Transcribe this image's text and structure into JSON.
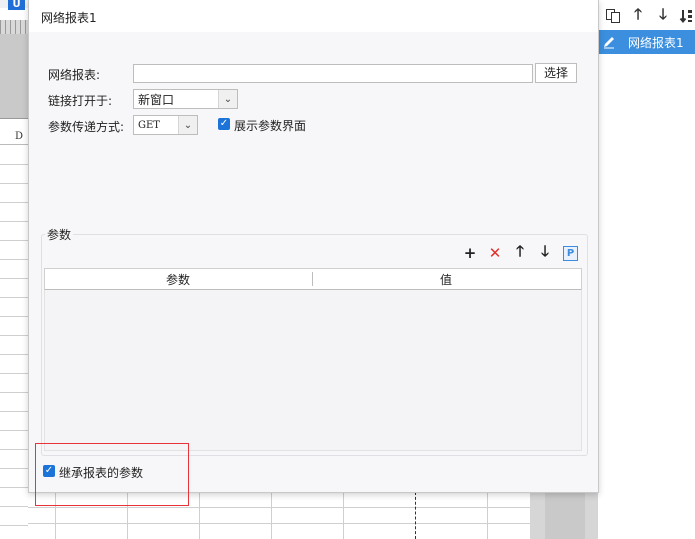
{
  "background": {
    "toolbar_badge": "U",
    "column_header": "D"
  },
  "dialog": {
    "title": "网络报表1",
    "report_label": "网络报表:",
    "report_value": "",
    "select_button": "选择",
    "link_open_label": "链接打开于:",
    "link_open_value": "新窗口",
    "param_method_label": "参数传递方式:",
    "param_method_value": "GET",
    "show_params_label": "展示参数界面",
    "show_params_checked": true,
    "params_group_title": "参数",
    "params_table": {
      "columns": [
        "参数",
        "值"
      ],
      "rows": []
    },
    "inherit_params_label": "继承报表的参数",
    "inherit_params_checked": true,
    "param_toolbar": {
      "add_icon": "plus-icon",
      "delete_icon": "close-icon",
      "up_icon": "arrow-up-icon",
      "down_icon": "arrow-down-icon",
      "p_button": "P"
    }
  },
  "right_panel": {
    "tools": [
      "copy-icon",
      "arrow-up-icon",
      "arrow-down-icon",
      "sort-icon"
    ],
    "items": [
      {
        "label": "网络报表1",
        "selected": true
      }
    ]
  },
  "colors": {
    "accent": "#1c74d9",
    "selected_item": "#3b8fde",
    "delete_red": "#e0312b",
    "highlight_box": "#e8333a"
  }
}
